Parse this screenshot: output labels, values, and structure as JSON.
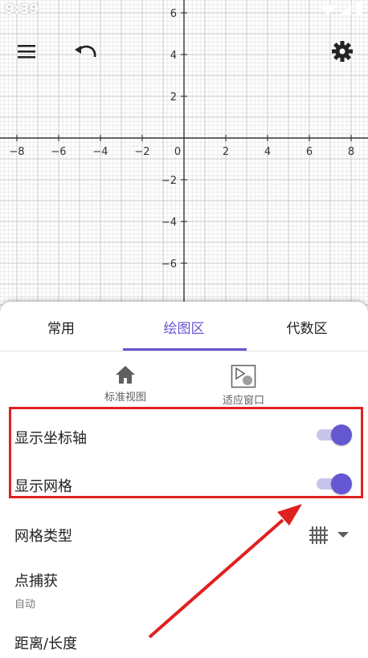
{
  "status": {
    "time": "9:39"
  },
  "graph": {
    "x_ticks": [
      "−8",
      "−6",
      "−4",
      "−2",
      "0",
      "2",
      "4",
      "6",
      "8"
    ],
    "y_ticks": [
      "6",
      "4",
      "2",
      "−2",
      "−4",
      "−6"
    ],
    "origin_label": "0"
  },
  "toolbar": {
    "menu_icon": "menu-icon",
    "undo_icon": "undo-icon",
    "settings_icon": "gear-icon"
  },
  "tabs": [
    {
      "label": "常用"
    },
    {
      "label": "绘图区"
    },
    {
      "label": "代数区"
    }
  ],
  "quick_actions": {
    "standard_view": "标准视图",
    "fit_window": "适应窗口"
  },
  "settings": {
    "show_axes": {
      "label": "显示坐标轴",
      "on": true
    },
    "show_grid": {
      "label": "显示网格",
      "on": true
    },
    "grid_type": {
      "label": "网格类型"
    },
    "point_capture": {
      "label": "点捕获",
      "value": "自动"
    },
    "distance": {
      "label": "距离/长度"
    }
  },
  "colors": {
    "accent": "#6557d2",
    "annotation": "#e02020"
  }
}
